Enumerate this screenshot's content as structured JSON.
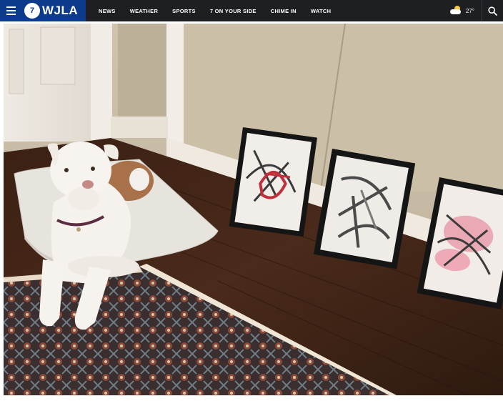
{
  "header": {
    "logo_badge": "7",
    "logo_text": "WJLA",
    "nav": [
      "NEWS",
      "WEATHER",
      "SPORTS",
      "7 ON YOUR SIDE",
      "CHIME IN",
      "WATCH"
    ],
    "weather_temp": "27°",
    "icons": {
      "menu": "hamburger-menu-icon",
      "weather": "partly-cloudy-icon",
      "search": "search-icon"
    }
  },
  "colors": {
    "header_bg": "#1d1f23",
    "brand_blue": "#0c3b8c"
  },
  "photo": {
    "description_tag": "dog-with-paintings-photo"
  }
}
